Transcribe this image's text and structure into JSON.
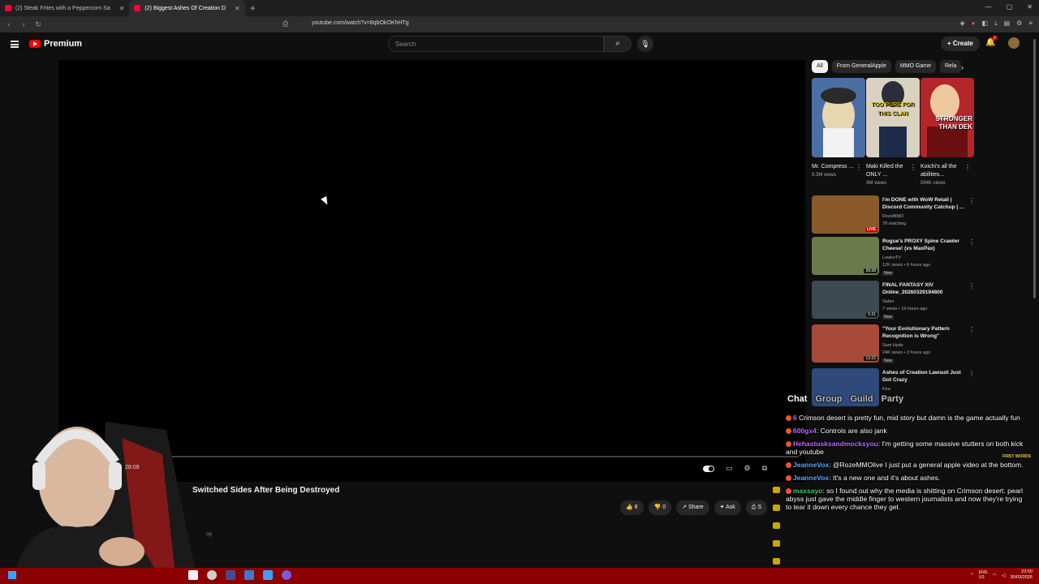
{
  "browser": {
    "tabs": [
      {
        "title": "(2) Steak Frites with a Peppercorn Sa",
        "active": false
      },
      {
        "title": "(2) Biggest Ashes Of Creation D",
        "active": true
      }
    ],
    "url": "youtube.com/watch?v=8qbOkOKhHTg"
  },
  "youtube": {
    "logo_text": "Premium",
    "search_placeholder": "Search",
    "create_label": "Create",
    "notification_count": "2"
  },
  "player": {
    "timecode": "28:09",
    "title": "Switched Sides After Being Destroyed",
    "channel_fragment": "og",
    "like_count": "8",
    "dislike_count": "0",
    "share_label": "Share",
    "ask_label": "Ask",
    "save_fragment": "S"
  },
  "sidebar": {
    "chips": [
      "All",
      "From GeneralApple",
      "MMO Game",
      "Rela"
    ],
    "shorts": [
      {
        "title": "Mr. Compress ...",
        "views": "9.3M views",
        "thumb_color": "#4a6fa5",
        "accent": "#e8d6b0"
      },
      {
        "title": "Maki Killed the ONLY ...",
        "views": "3M views",
        "thumb_color": "#d9d2c0",
        "accent": "#c9a800"
      },
      {
        "title": "Koichi's all the abilities...",
        "views": "594K views",
        "thumb_color": "#b3262a",
        "accent": "#ffffff"
      }
    ],
    "short_thumb_text": [
      "",
      "TOO PURE FOR THIS CLAN",
      "STRONGER THAN DEK"
    ],
    "recommendations": [
      {
        "title": "I'm DONE with WoW Retail | Discord Community Catchup | ...",
        "channel": "RozeMMO",
        "meta": "78 watching",
        "badge": "LIVE",
        "new": "",
        "thumb": "#8a5a2a"
      },
      {
        "title": "Rogue's PROXY Spine Crawler Cheese! (vs MaxPax)",
        "channel": "LowkoTV",
        "meta": "12K views • 6 hours ago",
        "badge": "39:38",
        "new": "New",
        "thumb": "#6b7a4a"
      },
      {
        "title": "FINAL FANTASY XIV Online_20260329194800",
        "channel": "Saber",
        "meta": "7 views • 19 hours ago",
        "badge": "5:31",
        "new": "New",
        "thumb": "#3e4a52"
      },
      {
        "title": "\"Your Evolutionary Pattern Recognition is Wrong\"",
        "channel": "Sam Hyde",
        "meta": "24K views • 3 hours ago",
        "badge": "13:22",
        "new": "New",
        "thumb": "#a84a3a"
      },
      {
        "title": "Ashes of Creation Lawsuit Just Got Crazy",
        "channel": "Kira",
        "meta": "",
        "badge": "",
        "new": "",
        "thumb": "#2e4a7a"
      }
    ]
  },
  "overlay": {
    "chat_tabs": [
      "Chat",
      "Group",
      "Guild",
      "Party"
    ],
    "first_words": "FIRST WORDS",
    "messages": [
      {
        "user": "6",
        "user_color": "#b36bff",
        "text": "Crimson desert is pretty fun, mid story but damn is the game actually fun"
      },
      {
        "user": "600gx4",
        "user_color": "#b36bff",
        "text": "Controls are also jank"
      },
      {
        "user": "Hehastusksandmocksyou",
        "user_color": "#b36bff",
        "text": "I'm getting some massive stutters on both kick and youtube"
      },
      {
        "user": "JeanneVox",
        "user_color": "#5aa8ff",
        "text": "@RozeMMOlive I just put a general apple video at the bottom."
      },
      {
        "user": "JeanneVox",
        "user_color": "#5aa8ff",
        "text": "It's a new one and it's about ashes."
      },
      {
        "user": "maxsayo",
        "user_color": "#3ecf5a",
        "text": "so I found out why the media is shitting on Crimson desert. pearl abyss just gave the middle finger to western journalists and now they're trying to tear it down every chance they get."
      }
    ]
  },
  "taskbar": {
    "lang": "ENG\nUS",
    "time": "23:50",
    "date": "30/03/2026"
  }
}
